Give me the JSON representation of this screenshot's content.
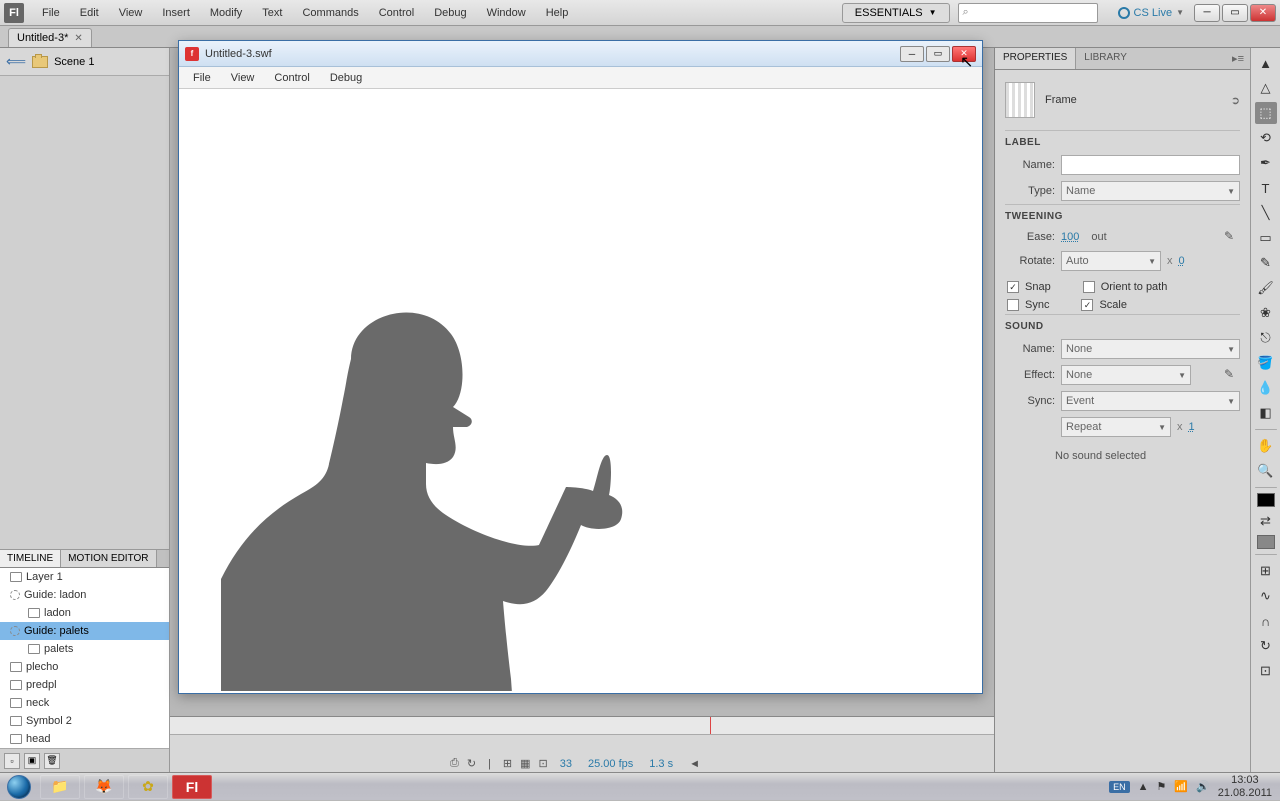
{
  "menubar": {
    "items": [
      "File",
      "Edit",
      "View",
      "Insert",
      "Modify",
      "Text",
      "Commands",
      "Control",
      "Debug",
      "Window",
      "Help"
    ],
    "workspace": "ESSENTIALS",
    "cslive": "CS Live"
  },
  "doctab": {
    "title": "Untitled-3*"
  },
  "scene": {
    "name": "Scene 1"
  },
  "timeline_tabs": {
    "timeline": "TIMELINE",
    "motion": "MOTION EDITOR"
  },
  "layers": [
    {
      "name": "Layer 1",
      "type": "layer"
    },
    {
      "name": "Guide: ladon",
      "type": "guide"
    },
    {
      "name": "ladon",
      "type": "layer",
      "indent": true
    },
    {
      "name": "Guide: palets",
      "type": "guide",
      "selected": true
    },
    {
      "name": "palets",
      "type": "layer",
      "indent": true
    },
    {
      "name": "plecho",
      "type": "layer"
    },
    {
      "name": "predpl",
      "type": "layer"
    },
    {
      "name": "neck",
      "type": "layer"
    },
    {
      "name": "Symbol 2",
      "type": "layer"
    },
    {
      "name": "head",
      "type": "layer"
    }
  ],
  "timeline_status": {
    "frame": "33",
    "fps": "25.00 fps",
    "time": "1.3 s"
  },
  "swf": {
    "title": "Untitled-3.swf",
    "menu": [
      "File",
      "View",
      "Control",
      "Debug"
    ]
  },
  "properties": {
    "tab_props": "PROPERTIES",
    "tab_lib": "LIBRARY",
    "obj_type": "Frame",
    "sect_label": "LABEL",
    "name_label": "Name:",
    "type_label": "Type:",
    "type_value": "Name",
    "sect_tween": "TWEENING",
    "ease_label": "Ease:",
    "ease_value": "100",
    "ease_dir": "out",
    "rotate_label": "Rotate:",
    "rotate_value": "Auto",
    "rotate_x": "x",
    "rotate_times": "0",
    "snap": "Snap",
    "orient": "Orient to path",
    "sync": "Sync",
    "scale": "Scale",
    "sect_sound": "SOUND",
    "sound_name_label": "Name:",
    "sound_name_value": "None",
    "effect_label": "Effect:",
    "effect_value": "None",
    "sync_label": "Sync:",
    "sync_value": "Event",
    "repeat_value": "Repeat",
    "repeat_x": "x",
    "repeat_times": "1",
    "no_sound": "No sound selected"
  },
  "taskbar": {
    "lang": "EN",
    "time": "13:03",
    "date": "21.08.2011"
  }
}
